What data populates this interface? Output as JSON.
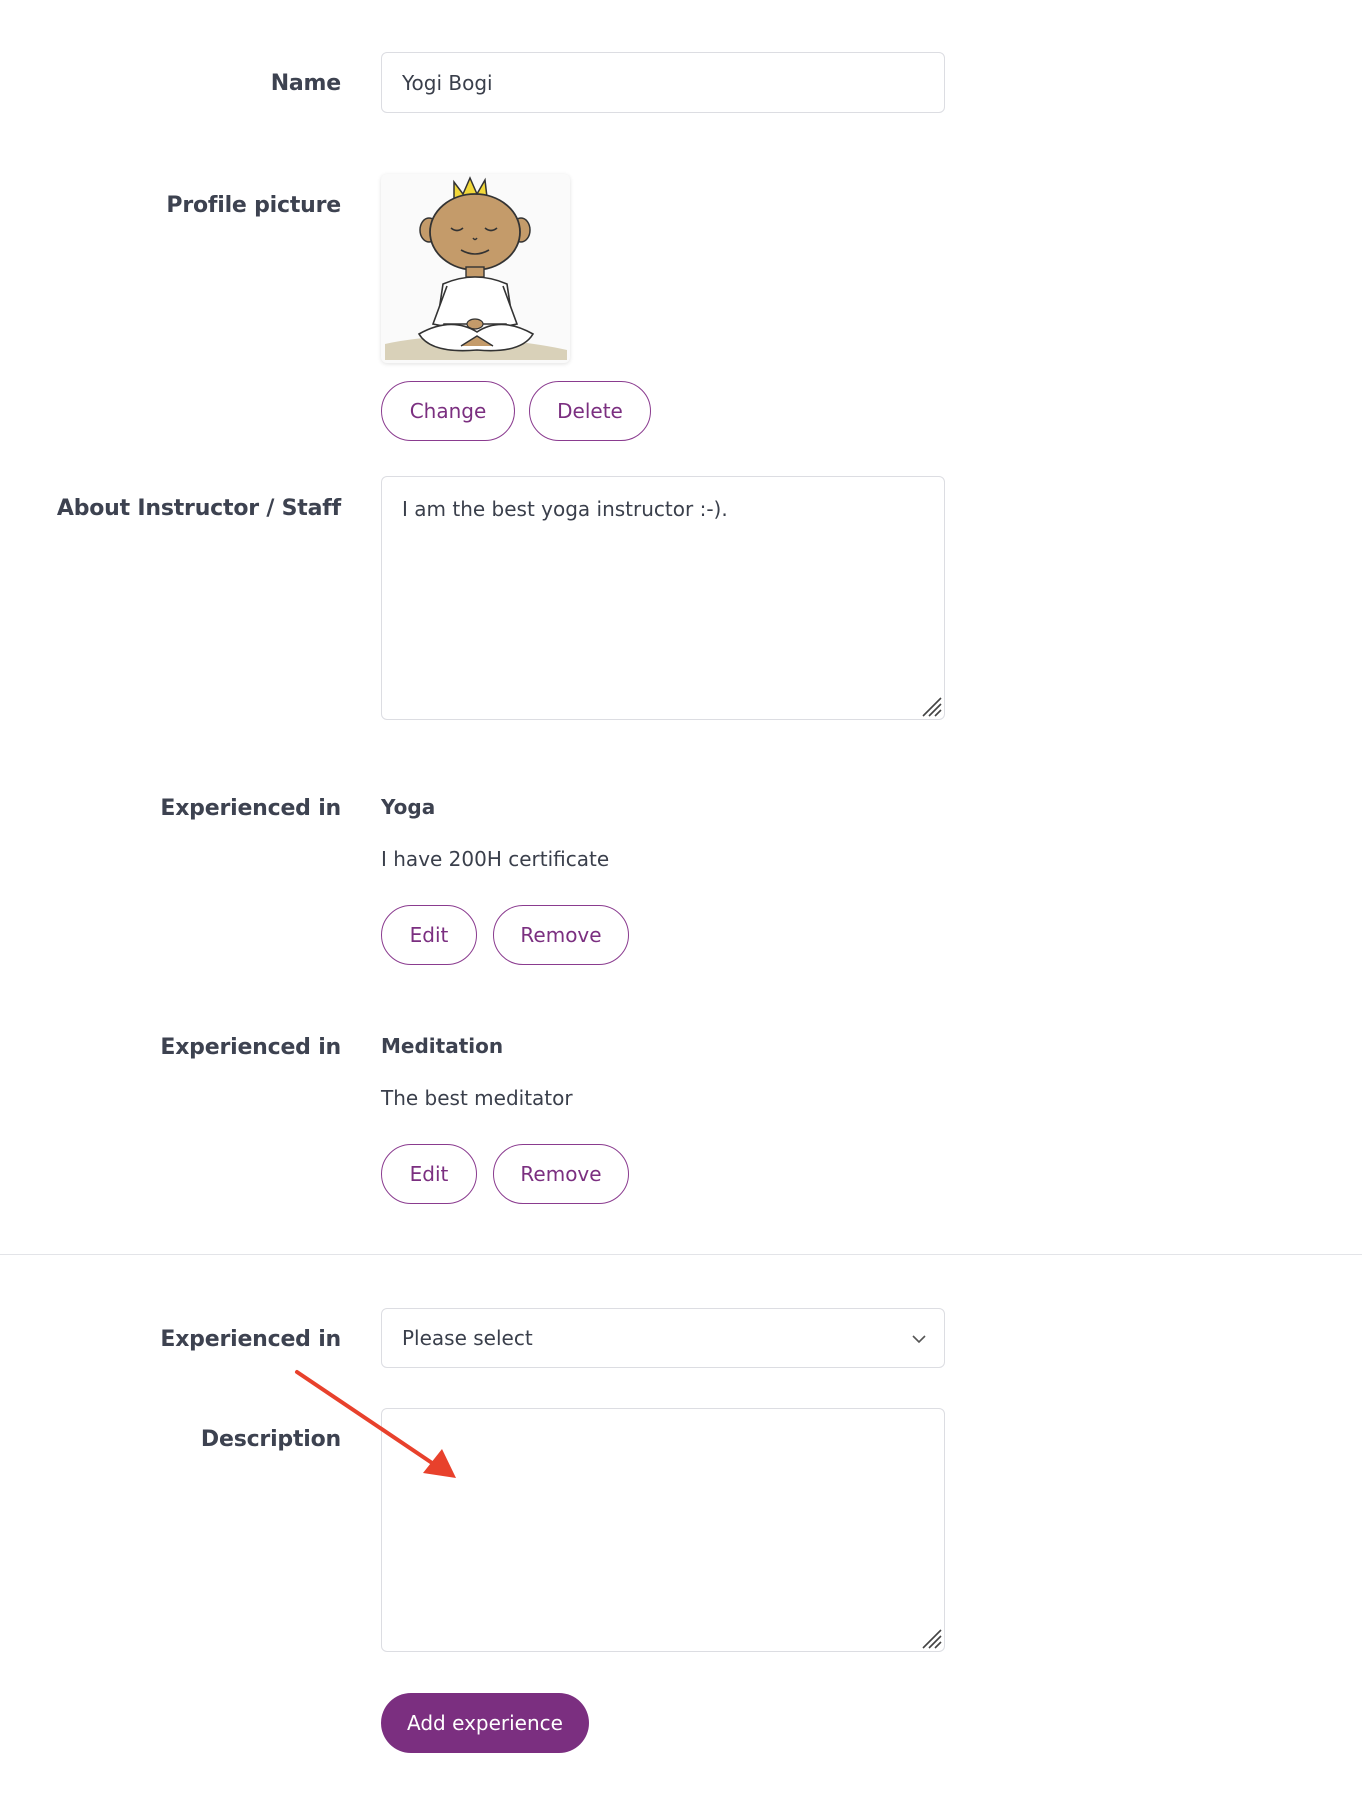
{
  "name": {
    "label": "Name",
    "value": "Yogi Bogi"
  },
  "profile_picture": {
    "label": "Profile picture",
    "change_label": "Change",
    "delete_label": "Delete"
  },
  "about": {
    "label": "About Instructor / Staff",
    "value": "I am the best yoga instructor :-)."
  },
  "experiences": [
    {
      "label": "Experienced in",
      "title": "Yoga",
      "description": "I have 200H certificate",
      "edit_label": "Edit",
      "remove_label": "Remove"
    },
    {
      "label": "Experienced in",
      "title": "Meditation",
      "description": "The best meditator",
      "edit_label": "Edit",
      "remove_label": "Remove"
    }
  ],
  "new_experience": {
    "label": "Experienced in",
    "select_value": "Please select",
    "description_label": "Description",
    "description_value": "",
    "add_label": "Add experience"
  },
  "colors": {
    "accent": "#7b2f80",
    "annotation_arrow": "#e8412c"
  }
}
